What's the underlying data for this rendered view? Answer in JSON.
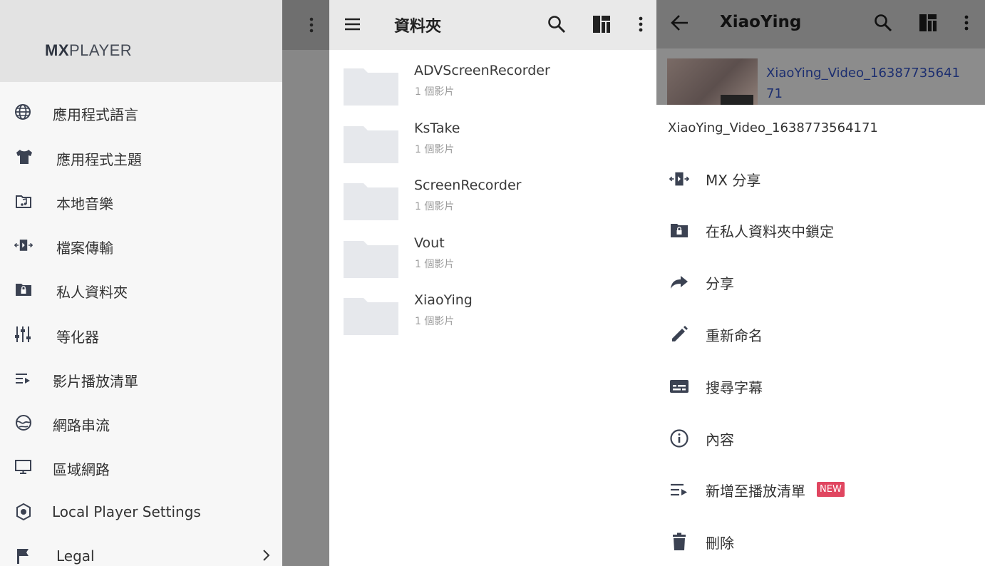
{
  "colors": {
    "drawer_bg": "#f7f7f7",
    "drawer_header_bg": "#e3e3e3",
    "appbar_bg": "#e9e9e9",
    "link_blue": "#1d2f70",
    "new_badge": "#e04660",
    "icon_dark": "#3b4252"
  },
  "drawer": {
    "brand_bold": "MX",
    "brand_rest": "PLAYER",
    "items": [
      {
        "label": "應用程式語言",
        "icon": "globe-icon"
      },
      {
        "label": "應用程式主題",
        "icon": "tshirt-icon"
      },
      {
        "label": "本地音樂",
        "icon": "music-folder-icon"
      },
      {
        "label": "檔案傳輸",
        "icon": "file-transfer-icon"
      },
      {
        "label": "私人資料夾",
        "icon": "private-folder-icon"
      },
      {
        "label": "等化器",
        "icon": "equalizer-icon"
      },
      {
        "label": "影片播放清單",
        "icon": "playlist-icon"
      },
      {
        "label": "網路串流",
        "icon": "network-stream-icon"
      },
      {
        "label": "區域網路",
        "icon": "monitor-icon"
      },
      {
        "label": "Local Player Settings",
        "icon": "settings-icon"
      },
      {
        "label": "Legal",
        "icon": "flag-icon"
      }
    ]
  },
  "folders_panel": {
    "title": "資料夾",
    "folders": [
      {
        "name": "ADVScreenRecorder",
        "count": "1 個影片"
      },
      {
        "name": "KsTake",
        "count": "1 個影片"
      },
      {
        "name": "ScreenRecorder",
        "count": "1 個影片"
      },
      {
        "name": "Vout",
        "count": "1 個影片"
      },
      {
        "name": "XiaoYing",
        "count": "1 個影片"
      }
    ]
  },
  "menu_panel": {
    "title": "XiaoYing",
    "video_link": "XiaoYing_Video_1638773564171",
    "sheet_title": "XiaoYing_Video_1638773564171",
    "items": [
      {
        "label": "MX 分享",
        "icon": "mx-share-icon"
      },
      {
        "label": "在私人資料夾中鎖定",
        "icon": "lock-folder-icon"
      },
      {
        "label": "分享",
        "icon": "share-icon"
      },
      {
        "label": "重新命名",
        "icon": "pencil-icon"
      },
      {
        "label": "搜尋字幕",
        "icon": "subtitles-icon"
      },
      {
        "label": "內容",
        "icon": "info-icon"
      },
      {
        "label": "新增至播放清單",
        "icon": "playlist-add-icon"
      },
      {
        "label": "刪除",
        "icon": "trash-icon"
      }
    ],
    "new_badge": "NEW"
  }
}
